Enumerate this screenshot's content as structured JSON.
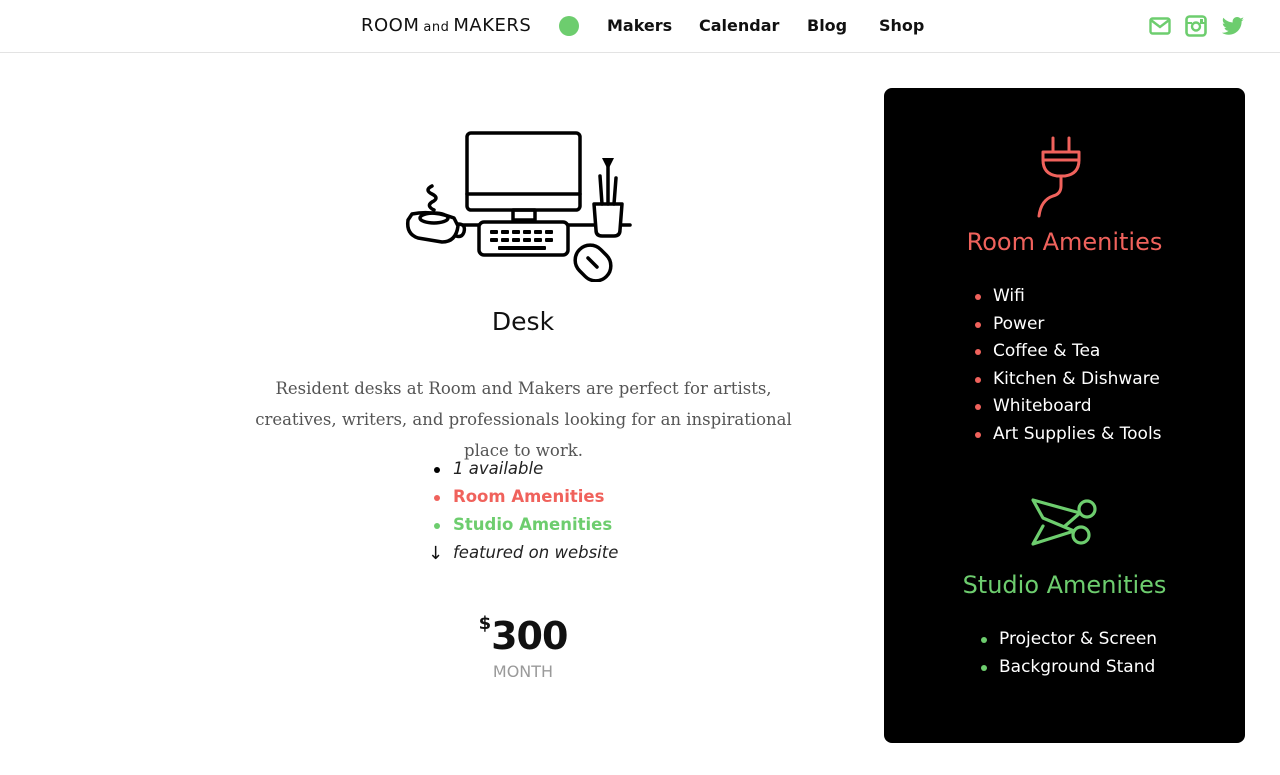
{
  "colors": {
    "accent_green": "#6dcd6e",
    "accent_red": "#f0625c",
    "panel_bg": "#000000"
  },
  "header": {
    "brand": {
      "part1": "ROOM",
      "and": "and",
      "part2": "MAKERS"
    },
    "status_dot_color": "#6dcd6e",
    "nav": [
      "Makers",
      "Calendar",
      "Blog",
      "Shop"
    ],
    "social_icons": [
      "mail-icon",
      "instagram-icon",
      "twitter-icon"
    ]
  },
  "listing": {
    "illustration": "desk-computer-icon",
    "title": "Desk",
    "description": "Resident desks at Room and Makers are perfect for artists, creatives, writers, and professionals looking for an inspirational place to work.",
    "features": [
      {
        "text": "1 available",
        "style": "italic"
      },
      {
        "text": "Room Amenities",
        "style": "red"
      },
      {
        "text": "Studio Amenities",
        "style": "green"
      },
      {
        "text": "featured on website",
        "style": "italic-arrow"
      }
    ],
    "price": {
      "currency": "$",
      "amount": "300",
      "period": "MONTH"
    }
  },
  "sidebar": {
    "room": {
      "icon": "plug-icon",
      "title": "Room Amenities",
      "items": [
        "Wifi",
        "Power",
        "Coffee & Tea",
        "Kitchen & Dishware",
        "Whiteboard",
        "Art Supplies & Tools"
      ]
    },
    "studio": {
      "icon": "scissors-icon",
      "title": "Studio Amenities",
      "items": [
        "Projector & Screen",
        "Background Stand"
      ]
    }
  }
}
